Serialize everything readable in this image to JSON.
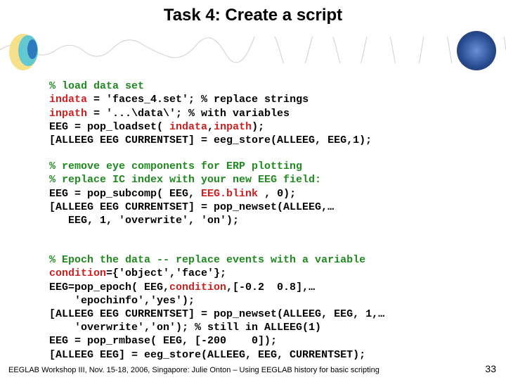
{
  "title": "Task 4: Create a script",
  "code": {
    "b1l1": "% load data set",
    "b1l2a": "indata",
    "b1l2b": " = 'faces_4.set'; % replace strings",
    "b1l3a": "inpath",
    "b1l3b": " = '...\\data\\'; % with variables",
    "b1l4a": "EEG = pop_loadset( ",
    "b1l4b": "indata",
    "b1l4c": ",",
    "b1l4d": "inpath",
    "b1l4e": ");",
    "b1l5": "[ALLEEG EEG CURRENTSET] = eeg_store(ALLEEG, EEG,1);",
    "b2l1": "% remove eye components for ERP plotting",
    "b2l2": "% replace IC index with your new EEG field:",
    "b2l3a": "EEG = pop_subcomp( EEG, ",
    "b2l3b": "EEG.blink",
    "b2l3c": " , 0);",
    "b2l4": "[ALLEEG EEG CURRENTSET] = pop_newset(ALLEEG,…",
    "b2l5": "   EEG, 1, 'overwrite', 'on');",
    "b3l1": "% Epoch the data -- replace events with a variable",
    "b3l2a": "condition",
    "b3l2b": "={'object','face'};",
    "b3l3a": "EEG=pop_epoch( EEG,",
    "b3l3b": "condition",
    "b3l3c": ",[-0.2  0.8],…",
    "b3l4": "    'epochinfo','yes');",
    "b3l5": "[ALLEEG EEG CURRENTSET] = pop_newset(ALLEEG, EEG, 1,…",
    "b3l6": "    'overwrite','on'); % still in ALLEEG(1)",
    "b3l7": "EEG = pop_rmbase( EEG, [-200    0]);",
    "b3l8": "[ALLEEG EEG] = eeg_store(ALLEEG, EEG, CURRENTSET);"
  },
  "footer": "EEGLAB Workshop III, Nov. 15-18, 2006, Singapore: Julie Onton – Using EEGLAB history for basic scripting",
  "page": "33"
}
